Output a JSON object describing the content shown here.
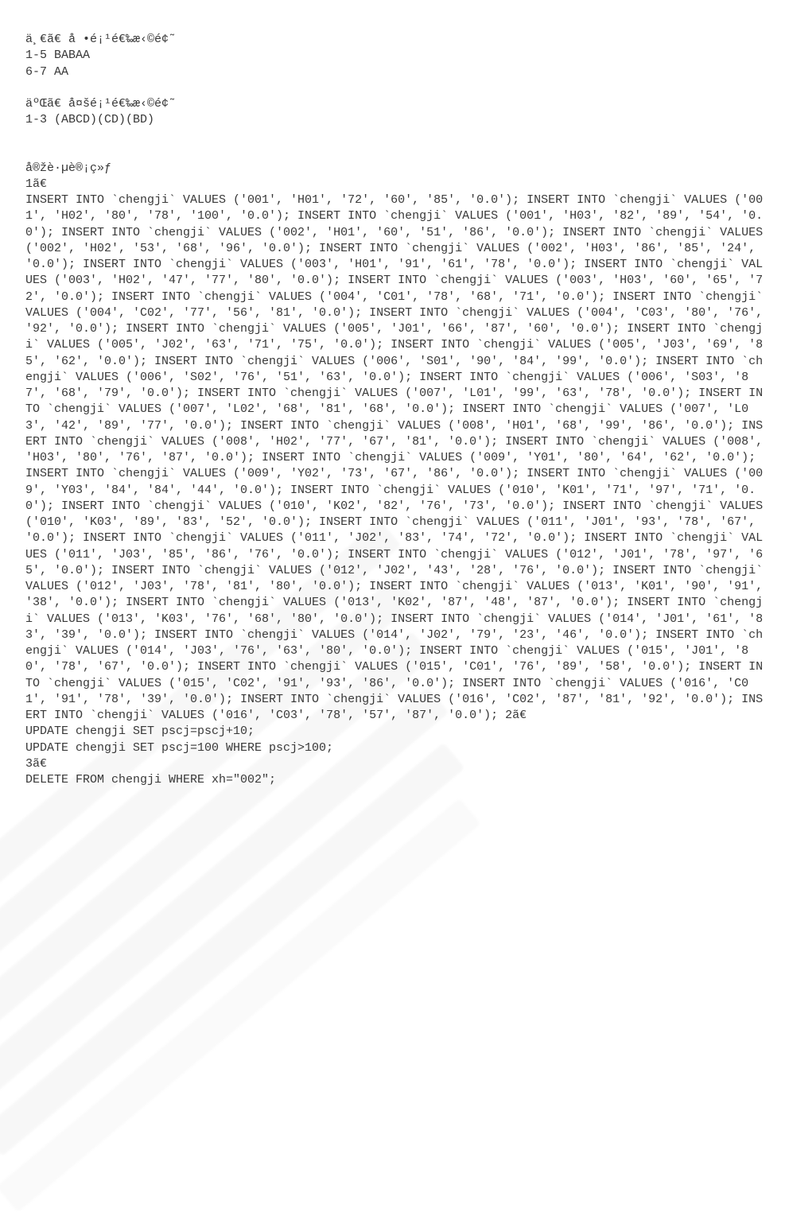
{
  "section1": {
    "title": "ä¸€ã€ å •é¡¹é€‰æ‹©é¢˜",
    "ans_1_5": "1-5 BABAA",
    "ans_6_7": "6-7 AA"
  },
  "section2": {
    "title": "äºŒã€ å¤šé¡¹é€‰æ‹©é¢˜",
    "ans_1_3": "1-3 (ABCD)(CD)(BD)"
  },
  "experiment": {
    "title": "å®žè·µè®¡ç»ƒ",
    "q1_label": "1ã€",
    "sql_body": "INSERT INTO `chengji` VALUES ('001', 'H01', '72', '60', '85', '0.0'); INSERT INTO `chengji` VALUES ('001', 'H02', '80', '78', '100', '0.0'); INSERT INTO `chengji` VALUES ('001', 'H03', '82', '89', '54', '0.0'); INSERT INTO `chengji` VALUES ('002', 'H01', '60', '51', '86', '0.0'); INSERT INTO `chengji` VALUES ('002', 'H02', '53', '68', '96', '0.0'); INSERT INTO `chengji` VALUES ('002', 'H03', '86', '85', '24', '0.0'); INSERT INTO `chengji` VALUES ('003', 'H01', '91', '61', '78', '0.0'); INSERT INTO `chengji` VALUES ('003', 'H02', '47', '77', '80', '0.0'); INSERT INTO `chengji` VALUES ('003', 'H03', '60', '65', '72', '0.0'); INSERT INTO `chengji` VALUES ('004', 'C01', '78', '68', '71', '0.0'); INSERT INTO `chengji` VALUES ('004', 'C02', '77', '56', '81', '0.0'); INSERT INTO `chengji` VALUES ('004', 'C03', '80', '76', '92', '0.0'); INSERT INTO `chengji` VALUES ('005', 'J01', '66', '87', '60', '0.0'); INSERT INTO `chengji` VALUES ('005', 'J02', '63', '71', '75', '0.0'); INSERT INTO `chengji` VALUES ('005', 'J03', '69', '85', '62', '0.0'); INSERT INTO `chengji` VALUES ('006', 'S01', '90', '84', '99', '0.0'); INSERT INTO `chengji` VALUES ('006', 'S02', '76', '51', '63', '0.0'); INSERT INTO `chengji` VALUES ('006', 'S03', '87', '68', '79', '0.0'); INSERT INTO `chengji` VALUES ('007', 'L01', '99', '63', '78', '0.0'); INSERT INTO `chengji` VALUES ('007', 'L02', '68', '81', '68', '0.0'); INSERT INTO `chengji` VALUES ('007', 'L03', '42', '89', '77', '0.0'); INSERT INTO `chengji` VALUES ('008', 'H01', '68', '99', '86', '0.0'); INSERT INTO `chengji` VALUES ('008', 'H02', '77', '67', '81', '0.0'); INSERT INTO `chengji` VALUES ('008', 'H03', '80', '76', '87', '0.0'); INSERT INTO `chengji` VALUES ('009', 'Y01', '80', '64', '62', '0.0'); INSERT INTO `chengji` VALUES ('009', 'Y02', '73', '67', '86', '0.0'); INSERT INTO `chengji` VALUES ('009', 'Y03', '84', '84', '44', '0.0'); INSERT INTO `chengji` VALUES ('010', 'K01', '71', '97', '71', '0.0'); INSERT INTO `chengji` VALUES ('010', 'K02', '82', '76', '73', '0.0'); INSERT INTO `chengji` VALUES ('010', 'K03', '89', '83', '52', '0.0'); INSERT INTO `chengji` VALUES ('011', 'J01', '93', '78', '67', '0.0'); INSERT INTO `chengji` VALUES ('011', 'J02', '83', '74', '72', '0.0'); INSERT INTO `chengji` VALUES ('011', 'J03', '85', '86', '76', '0.0'); INSERT INTO `chengji` VALUES ('012', 'J01', '78', '97', '65', '0.0'); INSERT INTO `chengji` VALUES ('012', 'J02', '43', '28', '76', '0.0'); INSERT INTO `chengji` VALUES ('012', 'J03', '78', '81', '80', '0.0'); INSERT INTO `chengji` VALUES ('013', 'K01', '90', '91', '38', '0.0'); INSERT INTO `chengji` VALUES ('013', 'K02', '87', '48', '87', '0.0'); INSERT INTO `chengji` VALUES ('013', 'K03', '76', '68', '80', '0.0'); INSERT INTO `chengji` VALUES ('014', 'J01', '61', '83', '39', '0.0'); INSERT INTO `chengji` VALUES ('014', 'J02', '79', '23', '46', '0.0'); INSERT INTO `chengji` VALUES ('014', 'J03', '76', '63', '80', '0.0'); INSERT INTO `chengji` VALUES ('015', 'J01', '80', '78', '67', '0.0'); INSERT INTO `chengji` VALUES ('015', 'C01', '76', '89', '58', '0.0'); INSERT INTO `chengji` VALUES ('015', 'C02', '91', '93', '86', '0.0'); INSERT INTO `chengji` VALUES ('016', 'C01', '91', '78', '39', '0.0'); INSERT INTO `chengji` VALUES ('016', 'C02', '87', '81', '92', '0.0'); INSERT INTO `chengji` VALUES ('016', 'C03', '78', '57', '87', '0.0'); 2ã€",
    "update1": "UPDATE chengji SET pscj=pscj+10;",
    "update2": "UPDATE chengji SET pscj=100 WHERE pscj>100;",
    "q3_label": "3ã€",
    "delete1": "DELETE FROM chengji WHERE xh=\"002\";"
  }
}
